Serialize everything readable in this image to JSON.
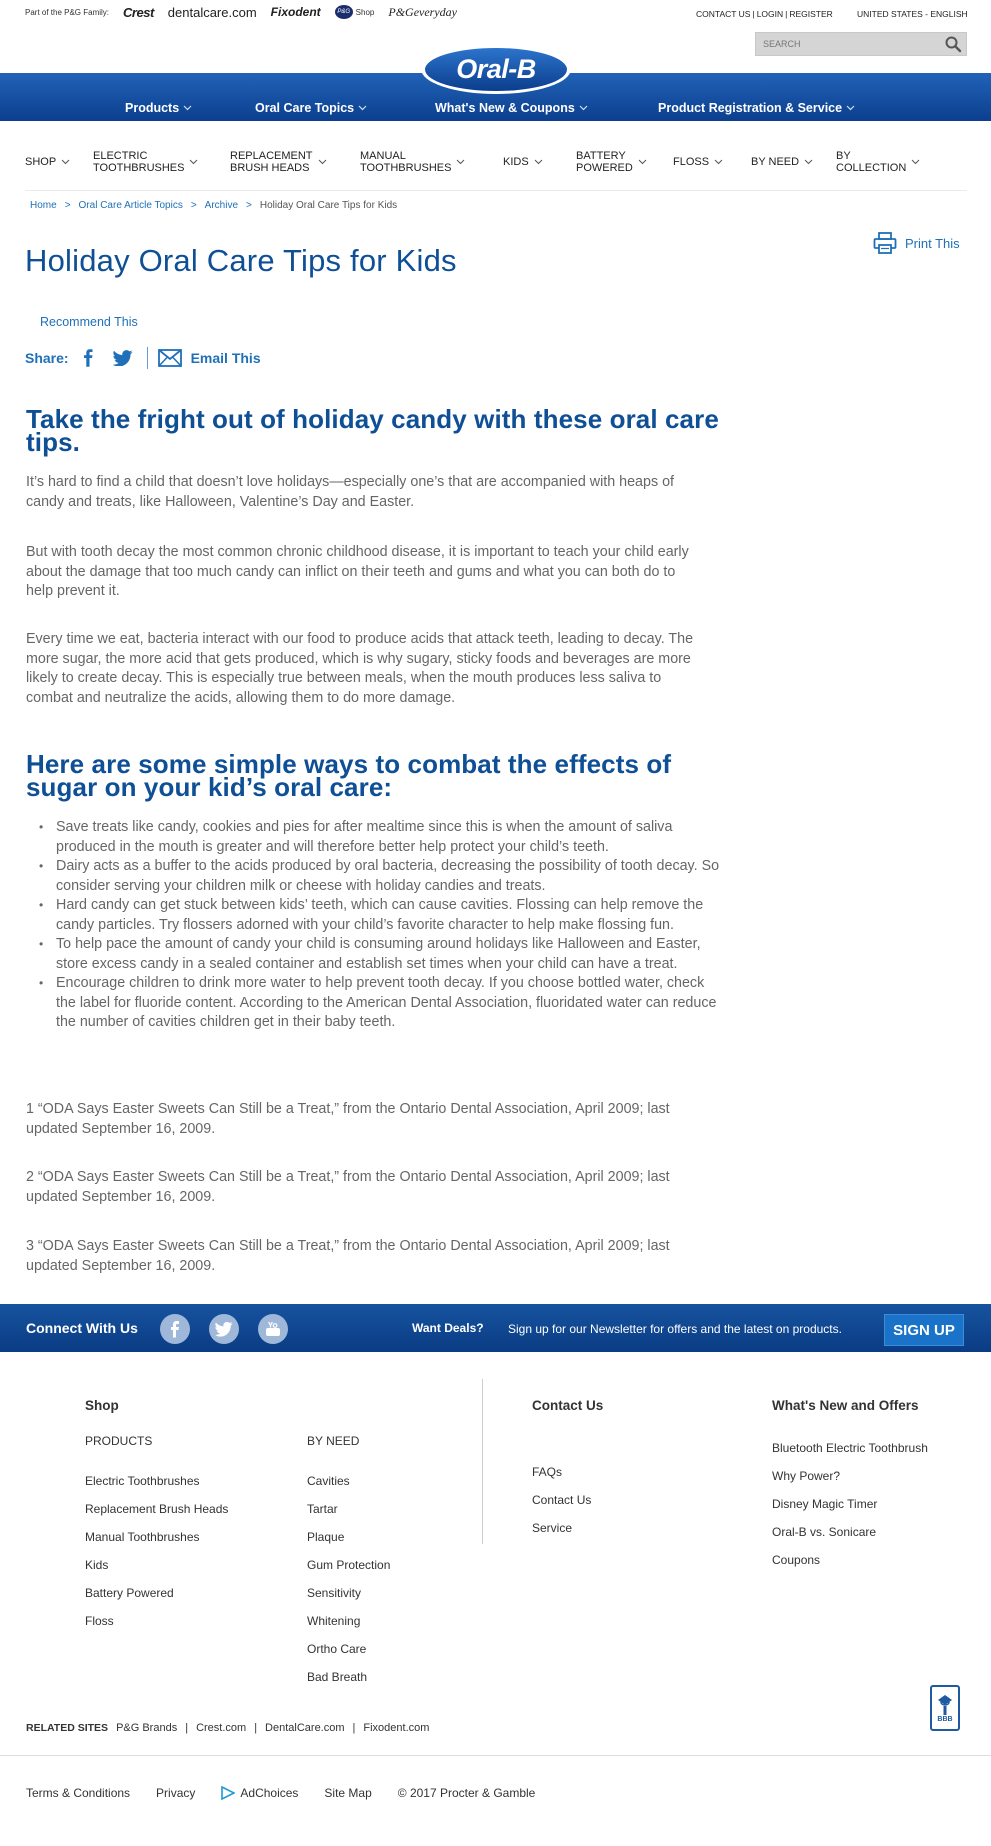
{
  "topbar": {
    "pg_family_label": "Part of the P&G Family:",
    "brands": [
      "Crest",
      "dentalcare.com",
      "Fixodent",
      "P&G",
      "Shop",
      "P&Geveryday"
    ],
    "utility_links": [
      "CONTACT US",
      "LOGIN",
      "REGISTER"
    ],
    "locale": "UNITED STATES - ENGLISH",
    "search_placeholder": "SEARCH"
  },
  "logo_text": "Oral-B",
  "main_nav": [
    "Products",
    "Oral Care Topics",
    "What's New & Coupons",
    "Product Registration & Service"
  ],
  "sub_nav": [
    "SHOP",
    "ELECTRIC\nTOOTHBRUSHES",
    "REPLACEMENT\nBRUSH HEADS",
    "MANUAL\nTOOTHBRUSHES",
    "KIDS",
    "BATTERY\nPOWERED",
    "FLOSS",
    "BY NEED",
    "BY\nCOLLECTION"
  ],
  "breadcrumb": {
    "items": [
      "Home",
      "Oral Care Article Topics",
      "Archive"
    ],
    "separator": ">",
    "current": "Holiday Oral Care Tips for Kids"
  },
  "print_label": "Print This",
  "page_title": "Holiday Oral Care Tips for Kids",
  "recommend_label": "Recommend This",
  "share": {
    "label": "Share:",
    "email_label": "Email This"
  },
  "article": {
    "heading1": "Take the fright out of holiday candy with these oral care tips.",
    "paragraphs": [
      "It’s hard to find a child that doesn’t love holidays—especially one’s that are accompanied with heaps of candy and treats, like Halloween, Valentine’s Day and Easter.",
      "But with tooth decay the most common chronic childhood disease, it is important to teach your child early about the damage that too much candy can inflict on their teeth and gums and what you can both do to help prevent it.",
      "Every time we eat, bacteria interact with our food to produce acids that attack teeth, leading to decay. The more sugar, the more acid that gets produced, which is why sugary, sticky foods and beverages are more likely to create decay. This is especially true between meals, when the mouth produces less saliva to combat and neutralize the acids, allowing them to do more damage."
    ],
    "heading2": "Here are some simple ways to combat the effects of sugar on your kid’s oral care:",
    "tips": [
      "Save treats like candy, cookies and pies for after mealtime since this is when the amount of saliva produced in the mouth is greater and will therefore better help protect your child’s teeth.",
      "Dairy acts as a buffer to the acids produced by oral bacteria, decreasing the possibility of tooth decay. So consider serving your children milk or cheese with holiday candies and treats.",
      "Hard candy can get stuck between kids’ teeth, which can cause cavities. Flossing can help remove the candy particles. Try flossers adorned with your child’s favorite character to help make flossing fun.",
      "To help pace the amount of candy your child is consuming around holidays like Halloween and Easter, store excess candy in a sealed container and establish set times when your child can have a treat.",
      "Encourage children to drink more water to help prevent tooth decay. If you choose bottled water, check the label for fluoride content. According to the American Dental Association, fluoridated water can reduce the number of cavities children get in their baby teeth."
    ],
    "footnotes": [
      "1 “ODA Says Easter Sweets Can Still be a Treat,” from the Ontario Dental Association, April 2009; last updated September 16, 2009.",
      "2 “ODA Says Easter Sweets Can Still be a Treat,” from the Ontario Dental Association, April 2009; last updated September 16, 2009.",
      "3 “ODA Says Easter Sweets Can Still be a Treat,” from the Ontario Dental Association, April 2009; last updated September 16, 2009."
    ]
  },
  "connect": {
    "label": "Connect With Us",
    "deals_label": "Want Deals?",
    "deals_text": "Sign up for our Newsletter for offers and the latest on products.",
    "signup_label": "SIGN UP"
  },
  "footer": {
    "shop_heading": "Shop",
    "products_heading": "PRODUCTS",
    "products": [
      "Electric Toothbrushes",
      "Replacement Brush Heads",
      "Manual Toothbrushes",
      "Kids",
      "Battery Powered",
      "Floss"
    ],
    "byneed_heading": "BY NEED",
    "byneed": [
      "Cavities",
      "Tartar",
      "Plaque",
      "Gum Protection",
      "Sensitivity",
      "Whitening",
      "Ortho Care",
      "Bad Breath"
    ],
    "contact_heading": "Contact Us",
    "contact_links": [
      "FAQs",
      "Contact Us",
      "Service"
    ],
    "whatsnew_heading": "What's New and Offers",
    "whatsnew_links": [
      "Bluetooth Electric Toothbrush",
      "Why Power?",
      "Disney Magic Timer",
      "Oral-B vs. Sonicare",
      "Coupons"
    ],
    "related_label": "RELATED SITES",
    "related_links": [
      "P&G Brands",
      "Crest.com",
      "DentalCare.com",
      "Fixodent.com"
    ],
    "bbb_text": "BBB",
    "legal_links": [
      "Terms & Conditions",
      "Privacy"
    ],
    "adchoices_label": "AdChoices",
    "sitemap_label": "Site Map",
    "copyright": "© 2017 Procter & Gamble"
  },
  "colors": {
    "brand_blue": "#0e4f96",
    "link_blue": "#1f70b8",
    "nav_gradient_top": "#2162b8",
    "nav_gradient_bottom": "#0c3f8e"
  }
}
